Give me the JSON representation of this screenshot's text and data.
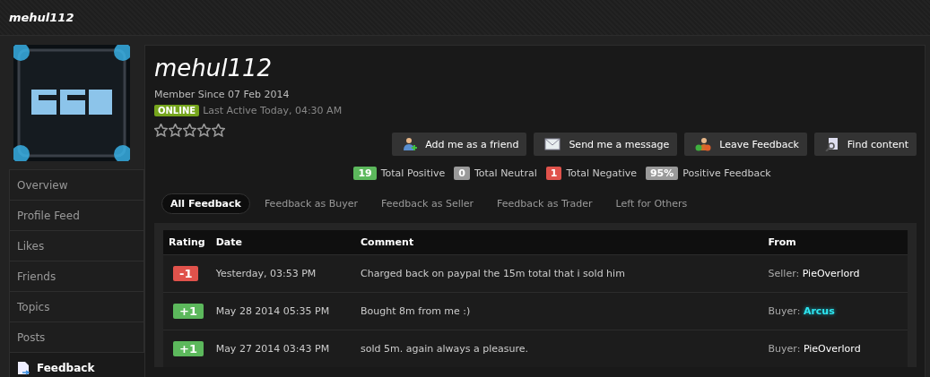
{
  "header": {
    "title": "mehul112"
  },
  "sidebar": {
    "items": [
      {
        "label": "Overview",
        "selected": false
      },
      {
        "label": "Profile Feed",
        "selected": false
      },
      {
        "label": "Likes",
        "selected": false
      },
      {
        "label": "Friends",
        "selected": false
      },
      {
        "label": "Topics",
        "selected": false
      },
      {
        "label": "Posts",
        "selected": false
      },
      {
        "label": "Feedback",
        "selected": true
      }
    ]
  },
  "profile": {
    "name": "mehul112",
    "member_since": "Member Since 07 Feb 2014",
    "status": "ONLINE",
    "last_active": "Last Active Today, 04:30 AM",
    "stars": 0
  },
  "buttons": [
    {
      "label": "Add me as a friend",
      "kind": "friend"
    },
    {
      "label": "Send me a message",
      "kind": "message"
    },
    {
      "label": "Leave Feedback",
      "kind": "feedback"
    },
    {
      "label": "Find content",
      "kind": "find"
    }
  ],
  "totals": [
    {
      "count": "19",
      "label": "Total Positive",
      "kind": "positive"
    },
    {
      "count": "0",
      "label": "Total Neutral",
      "kind": "neutral"
    },
    {
      "count": "1",
      "label": "Total Negative",
      "kind": "negative"
    },
    {
      "count": "95%",
      "label": "Positive Feedback",
      "kind": "neutral"
    }
  ],
  "tabs": [
    {
      "label": "All Feedback",
      "selected": true
    },
    {
      "label": "Feedback as Buyer",
      "selected": false
    },
    {
      "label": "Feedback as Seller",
      "selected": false
    },
    {
      "label": "Feedback as Trader",
      "selected": false
    },
    {
      "label": "Left for Others",
      "selected": false
    }
  ],
  "table": {
    "columns": [
      "Rating",
      "Date",
      "Comment",
      "From"
    ],
    "rows": [
      {
        "rating": "-1",
        "kind": "negative",
        "date": "Yesterday, 03:53 PM",
        "comment": "Charged back on paypal the 15m total that i sold him",
        "role": "Seller:",
        "from": "PieOverlord",
        "highlighted": false
      },
      {
        "rating": "+1",
        "kind": "positive",
        "date": "May 28 2014 05:35 PM",
        "comment": "Bought 8m from me :)",
        "role": "Buyer:",
        "from": "Arcus",
        "highlighted": true
      },
      {
        "rating": "+1",
        "kind": "positive",
        "date": "May 27 2014 03:43 PM",
        "comment": "sold 5m. again always a pleasure.",
        "role": "Buyer:",
        "from": "PieOverlord",
        "highlighted": false
      }
    ]
  }
}
